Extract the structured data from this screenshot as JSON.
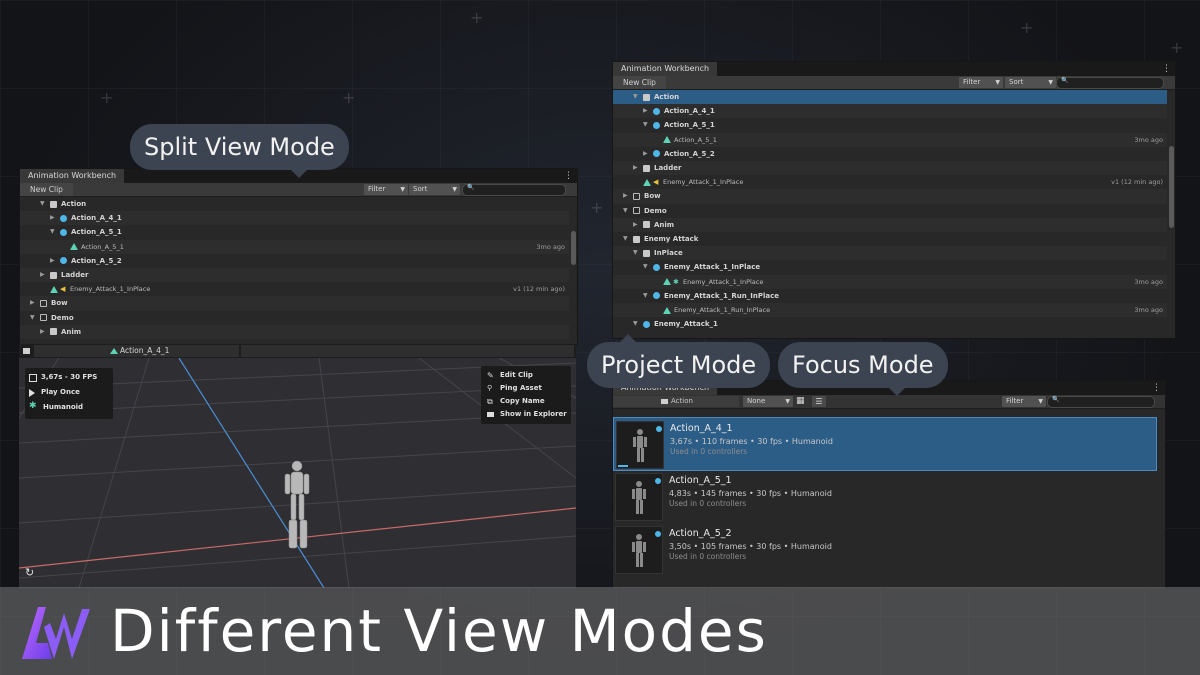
{
  "callouts": {
    "split": "Split View Mode",
    "project": "Project Mode",
    "focus": "Focus Mode"
  },
  "window_title": "Animation Workbench",
  "toolbar": {
    "new_clip": "New Clip",
    "filter": "Filter",
    "sort": "Sort"
  },
  "split_tree": [
    {
      "label": "Action",
      "indent": 3,
      "icon": "folder",
      "caret": "▼",
      "bold": true
    },
    {
      "label": "Action_A_4_1",
      "indent": 4,
      "icon": "anim",
      "caret": "▶",
      "bold": true
    },
    {
      "label": "Action_A_5_1",
      "indent": 4,
      "icon": "anim",
      "caret": "▼",
      "bold": true
    },
    {
      "label": "Action_A_5_1",
      "indent": 5,
      "icon": "clip",
      "caret": "",
      "bold": false,
      "right": "3mo ago"
    },
    {
      "label": "Action_A_5_2",
      "indent": 4,
      "icon": "anim",
      "caret": "▶",
      "bold": true
    },
    {
      "label": "Ladder",
      "indent": 3,
      "icon": "folder",
      "caret": "▶",
      "bold": true
    },
    {
      "label": "Enemy_Attack_1_InPlace",
      "indent": 3,
      "icon": "clip-audio",
      "caret": "",
      "bold": false,
      "right": "v1 (12 min ago)"
    },
    {
      "label": "Bow",
      "indent": 2,
      "icon": "folder-o",
      "caret": "▶",
      "bold": true
    },
    {
      "label": "Demo",
      "indent": 2,
      "icon": "folder-o",
      "caret": "▼",
      "bold": true
    },
    {
      "label": "Anim",
      "indent": 3,
      "icon": "folder",
      "caret": "▶",
      "bold": true
    }
  ],
  "project_tree": [
    {
      "label": "Action",
      "indent": 3,
      "icon": "folder",
      "caret": "▼",
      "bold": true,
      "selected": true
    },
    {
      "label": "Action_A_4_1",
      "indent": 4,
      "icon": "anim",
      "caret": "▶",
      "bold": true
    },
    {
      "label": "Action_A_5_1",
      "indent": 4,
      "icon": "anim",
      "caret": "▼",
      "bold": true
    },
    {
      "label": "Action_A_5_1",
      "indent": 5,
      "icon": "clip",
      "caret": "",
      "bold": false,
      "right": "3mo ago"
    },
    {
      "label": "Action_A_5_2",
      "indent": 4,
      "icon": "anim",
      "caret": "▶",
      "bold": true
    },
    {
      "label": "Ladder",
      "indent": 3,
      "icon": "folder",
      "caret": "▶",
      "bold": true
    },
    {
      "label": "Enemy_Attack_1_InPlace",
      "indent": 3,
      "icon": "clip-audio",
      "caret": "",
      "bold": false,
      "right": "v1 (12 min ago)"
    },
    {
      "label": "Bow",
      "indent": 2,
      "icon": "folder-o",
      "caret": "▶",
      "bold": true
    },
    {
      "label": "Demo",
      "indent": 2,
      "icon": "folder-o",
      "caret": "▼",
      "bold": true
    },
    {
      "label": "Anim",
      "indent": 3,
      "icon": "folder",
      "caret": "▶",
      "bold": true
    },
    {
      "label": "Enemy Attack",
      "indent": 2,
      "icon": "folder",
      "caret": "▼",
      "bold": true
    },
    {
      "label": "InPlace",
      "indent": 3,
      "icon": "folder",
      "caret": "▼",
      "bold": true
    },
    {
      "label": "Enemy_Attack_1_InPlace",
      "indent": 4,
      "icon": "anim",
      "caret": "▼",
      "bold": true
    },
    {
      "label": "Enemy_Attack_1_InPlace",
      "indent": 5,
      "icon": "clip-figure",
      "caret": "",
      "bold": false,
      "right": "3mo ago"
    },
    {
      "label": "Enemy_Attack_1_Run_InPlace",
      "indent": 4,
      "icon": "anim",
      "caret": "▼",
      "bold": true
    },
    {
      "label": "Enemy_Attack_1_Run_InPlace",
      "indent": 5,
      "icon": "clip",
      "caret": "",
      "bold": false,
      "right": "3mo ago"
    },
    {
      "label": "Enemy_Attack_1",
      "indent": 3,
      "icon": "anim",
      "caret": "▼",
      "bold": true
    }
  ],
  "viewport": {
    "clip_name": "Action_A_4_1",
    "stats": "3,67s - 30 FPS",
    "play_mode": "Play Once",
    "rig": "Humanoid",
    "context_menu": [
      "Edit Clip",
      "Ping Asset",
      "Copy Name",
      "Show in Explorer"
    ]
  },
  "focus": {
    "window_title": "Animation Workbench",
    "folder": "Action",
    "none_option": "None",
    "filter": "Filter",
    "cards": [
      {
        "title": "Action_A_4_1",
        "info": "3,67s • 110 frames • 30 fps • Humanoid",
        "used": "Used in 0 controllers",
        "selected": true
      },
      {
        "title": "Action_A_5_1",
        "info": "4,83s • 145 frames • 30 fps • Humanoid",
        "used": "Used in 0 controllers",
        "selected": false
      },
      {
        "title": "Action_A_5_2",
        "info": "3,50s • 105 frames • 30 fps • Humanoid",
        "used": "Used in 0 controllers",
        "selected": false
      }
    ]
  },
  "banner": {
    "title": "Different View Modes"
  },
  "colors": {
    "selection": "#2c5d87",
    "accent_clip": "#5ed3b6",
    "accent_anim": "#4fb6e8"
  }
}
